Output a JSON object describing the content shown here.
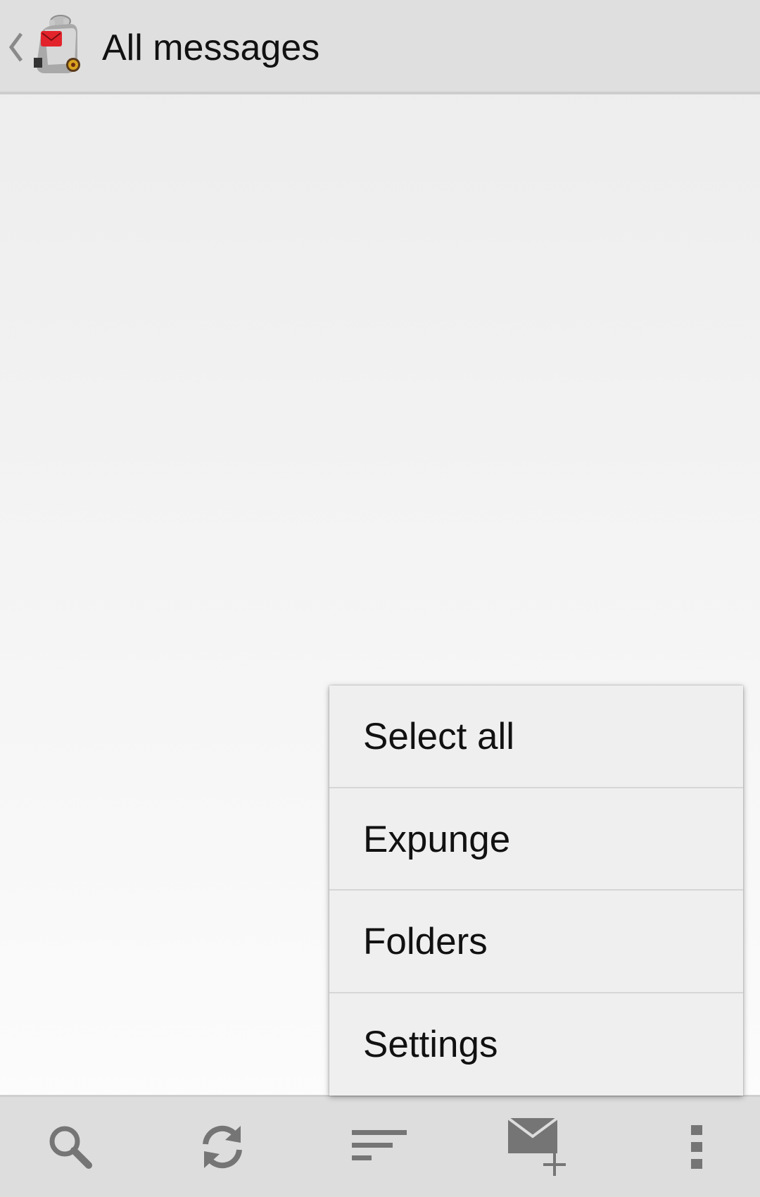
{
  "header": {
    "title": "All messages",
    "back_icon": "chevron-left-icon",
    "logo_icon": "app-logo-icon"
  },
  "overflow_menu": {
    "items": [
      {
        "label": "Select all"
      },
      {
        "label": "Expunge"
      },
      {
        "label": "Folders"
      },
      {
        "label": "Settings"
      }
    ]
  },
  "bottom_bar": {
    "buttons": [
      {
        "icon": "search-icon"
      },
      {
        "icon": "refresh-icon"
      },
      {
        "icon": "sort-icon"
      },
      {
        "icon": "compose-icon"
      },
      {
        "icon": "more-vert-icon"
      }
    ]
  },
  "colors": {
    "action_bar": "#dfdfdf",
    "bottom_bar": "#dddddd",
    "menu_bg": "#efefef",
    "icon_gray": "#757575",
    "logo_red": "#e3232b"
  }
}
